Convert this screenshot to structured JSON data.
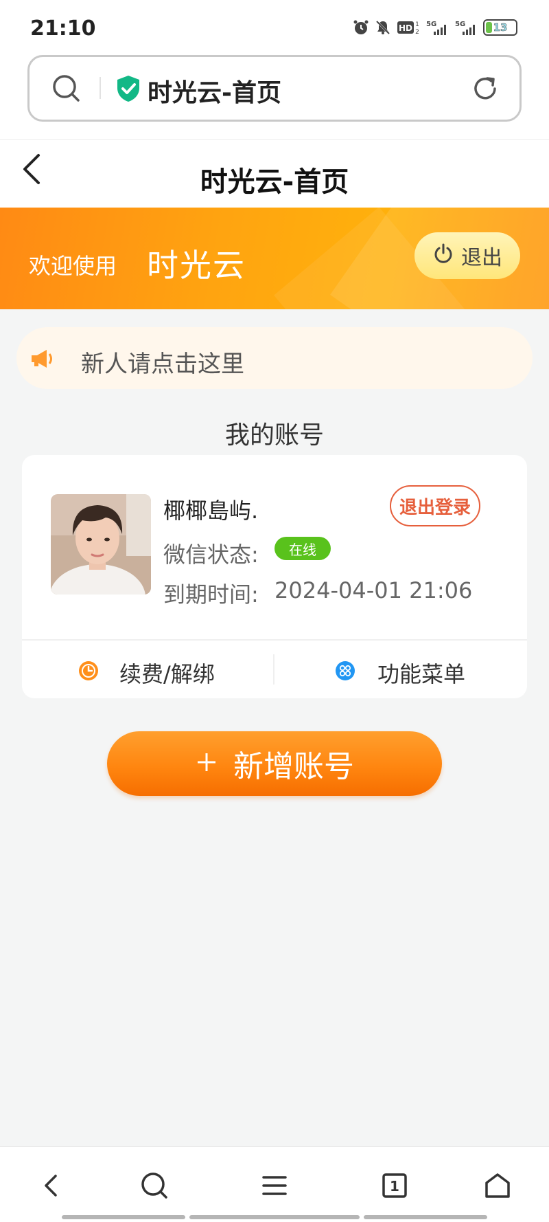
{
  "status_bar": {
    "time": "21:10",
    "battery": "13",
    "signal1": "5G",
    "signal2": "5G",
    "hd": "HD"
  },
  "browser": {
    "title": "时光云-首页"
  },
  "header": {
    "title": "时光云-首页"
  },
  "banner": {
    "welcome": "欢迎使用",
    "brand": "时光云",
    "logout": "退出"
  },
  "notice": {
    "text": "新人请点击这里"
  },
  "account_section": {
    "title": "我的账号"
  },
  "account": {
    "name": "椰椰島屿.",
    "logout_label": "退出登录",
    "wechat_status_label": "微信状态:",
    "wechat_status_value": "在线",
    "expire_label": "到期时间:",
    "expire_value": "2024-04-01 21:06",
    "renew_label": "续费/解绑",
    "menu_label": "功能菜单"
  },
  "add_account": {
    "label": "新增账号"
  },
  "bottom_nav": {
    "tab_count": "1"
  },
  "colors": {
    "accent_orange": "#ff8a14",
    "status_green": "#59c21c",
    "logout_red": "#e65f3c"
  },
  "icons": [
    "alarm-icon",
    "mute-bell-icon",
    "hd-icon",
    "signal-icon",
    "battery-icon",
    "search-icon",
    "shield-check-icon",
    "reload-icon",
    "back-arrow-icon",
    "power-icon",
    "megaphone-icon",
    "clock-icon",
    "grid-menu-icon",
    "plus-icon",
    "home-icon",
    "tabs-icon"
  ]
}
